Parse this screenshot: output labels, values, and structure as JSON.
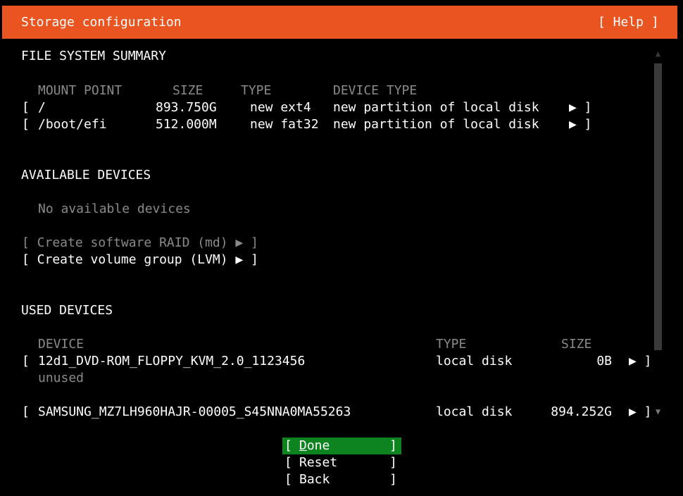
{
  "header": {
    "title": "Storage configuration",
    "help_label": "[ Help ]",
    "bg_color": "#e95420"
  },
  "fs_summary": {
    "heading": "FILE SYSTEM SUMMARY",
    "columns": {
      "mount_point": "MOUNT POINT",
      "size": "SIZE",
      "type": "TYPE",
      "device_type": "DEVICE TYPE"
    },
    "rows": [
      {
        "open": "[",
        "mount": "/",
        "size": "893.750G",
        "type": "new ext4",
        "device_type": "new partition of local disk",
        "arrow": "▶ ]"
      },
      {
        "open": "[",
        "mount": "/boot/efi",
        "size": "512.000M",
        "type": "new fat32",
        "device_type": "new partition of local disk",
        "arrow": "▶ ]"
      }
    ]
  },
  "available": {
    "heading": "AVAILABLE DEVICES",
    "empty_text": "No available devices",
    "raid_label": "[ Create software RAID (md) ▶ ]",
    "lvm_label": "[ Create volume group (LVM) ▶ ]"
  },
  "used": {
    "heading": "USED DEVICES",
    "columns": {
      "device": "DEVICE",
      "type": "TYPE",
      "size": "SIZE"
    },
    "rows": [
      {
        "open": "[",
        "device": "12d1_DVD-ROM_FLOPPY_KVM_2.0_1123456",
        "type": "local disk",
        "size": "0B",
        "arrow": "▶ ]",
        "note": "unused"
      },
      {
        "open": "[",
        "device": "SAMSUNG_MZ7LH960HAJR-00005_S45NNA0MA55263",
        "type": "local disk",
        "size": "894.252G",
        "arrow": "▶ ]"
      }
    ]
  },
  "scrollbar": {
    "up_arrow": "▲",
    "down_arrow": "▼"
  },
  "buttons": {
    "open_bracket": "[",
    "close_bracket": "]",
    "done_first": "D",
    "done_rest": "one",
    "reset": "Reset",
    "back": "Back",
    "selected_color": "#0e8420"
  }
}
